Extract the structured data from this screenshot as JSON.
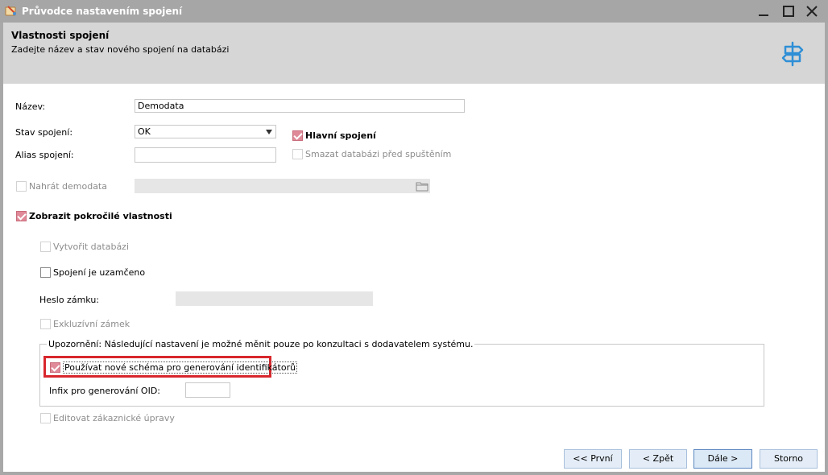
{
  "window": {
    "title": "Průvodce nastavením spojení"
  },
  "header": {
    "title": "Vlastnosti spojení",
    "subtitle": "Zadejte název a stav nového spojení na databázi"
  },
  "form": {
    "name_label": "Název:",
    "name_value": "Demodata",
    "state_label": "Stav spojení:",
    "state_value": "OK",
    "main_connection_label": "Hlavní spojení",
    "alias_label": "Alias spojení:",
    "alias_value": "",
    "delete_db_label": "Smazat databázi před spuštěním",
    "load_demo_label": "Nahrát demodata",
    "show_advanced_label": "Zobrazit pokročilé vlastnosti",
    "create_db_label": "Vytvořit databázi",
    "locked_label": "Spojení je uzamčeno",
    "lock_password_label": "Heslo zámku:",
    "exclusive_lock_label": "Exkluzívní zámek",
    "warning_legend": "Upozornění: Následující nastavení je možné měnit pouze po konzultaci s dodavatelem systému.",
    "new_schema_label": "Používat nové schéma pro generování identifikátorů",
    "infix_label": "Infix pro generování OID:",
    "infix_value": "",
    "edit_custom_label": "Editovat zákaznické úpravy"
  },
  "buttons": {
    "first": "<< První",
    "back": "< Zpět",
    "next": "Dále >",
    "cancel": "Storno"
  },
  "colors": {
    "checkbox_checked": "#e08a99",
    "highlight": "#d8262c",
    "header_bg": "#d6d6d6",
    "titlebar_bg": "#a6a6a6"
  }
}
